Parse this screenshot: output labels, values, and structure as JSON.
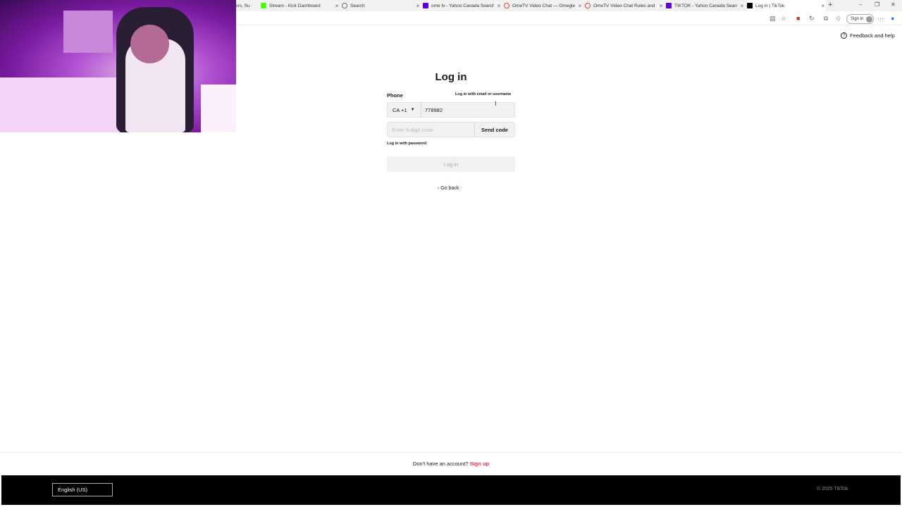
{
  "browser": {
    "tabs": [
      {
        "title": "ers, Su",
        "favicon_color": "#4caf50",
        "active": false
      },
      {
        "title": "Stream - Kick Dashboard",
        "favicon_color": "#53fc18",
        "active": false
      },
      {
        "title": "Search",
        "favicon_color": "#666666",
        "active": false
      },
      {
        "title": "ome tv - Yahoo Canada Search R",
        "favicon_color": "#6001d2",
        "active": false
      },
      {
        "title": "OmeTV Video Chat — Omegle A",
        "favicon_color": "#e53935",
        "active": false
      },
      {
        "title": "OmeTV Video Chat Rules and R",
        "favicon_color": "#e53935",
        "active": false
      },
      {
        "title": "TIKTOK - Yahoo Canada Search",
        "favicon_color": "#6001d2",
        "active": false
      },
      {
        "title": "Log in | TikTok",
        "favicon_color": "#000000",
        "active": true
      }
    ],
    "new_tab": "+",
    "sign_in": "Sign in"
  },
  "page": {
    "feedback": "Feedback and help",
    "title": "Log in",
    "phone_label": "Phone",
    "alt_login": "Log in with email or username",
    "country_code": "CA +1",
    "phone_value": "778982",
    "code_placeholder": "Enter 6-digit code",
    "send_code": "Send code",
    "password_login": "Log in with password",
    "login_button": "Log in",
    "go_back": "Go back",
    "no_account": "Don't have an account?",
    "sign_up": "Sign up"
  },
  "footer": {
    "language": "English (US)",
    "copyright": "© 2025 TikTok"
  },
  "colors": {
    "accent": "#fe2c55",
    "text": "#161823",
    "footer_bg": "#000000"
  }
}
